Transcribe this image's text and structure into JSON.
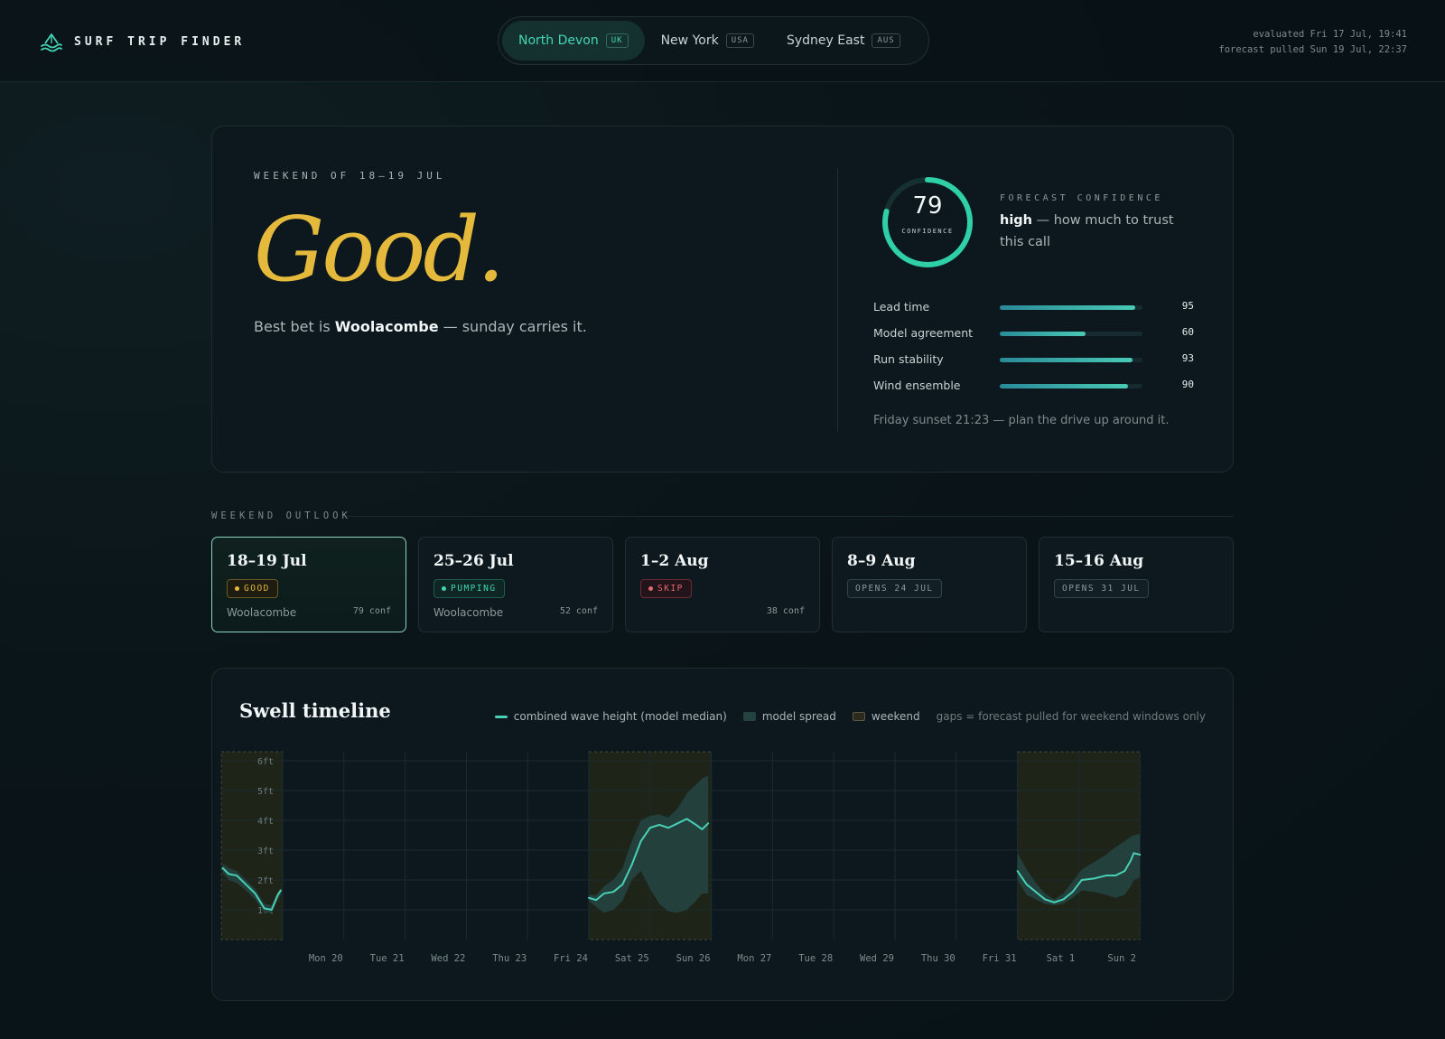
{
  "app": {
    "name": "SURF TRIP FINDER"
  },
  "locations": [
    {
      "name": "North Devon",
      "code": "UK",
      "active": true
    },
    {
      "name": "New York",
      "code": "USA",
      "active": false
    },
    {
      "name": "Sydney East",
      "code": "AUS",
      "active": false
    }
  ],
  "meta": {
    "evaluated": "evaluated Fri 17 Jul, 19:41",
    "forecast": "forecast pulled Sun 19 Jul, 22:37"
  },
  "hero": {
    "eyebrow": "WEEKEND OF 18–19 JUL",
    "verdict": "Good.",
    "best_prefix": "Best bet is ",
    "best_spot": "Woolacombe",
    "best_suffix": " — sunday carries it.",
    "confidence": {
      "value": 79,
      "ring_label": "CONFIDENCE",
      "label": "FORECAST CONFIDENCE",
      "level": "high",
      "text": " — how much to trust this call",
      "color": "#2fd0a8"
    },
    "metrics": [
      {
        "name": "Lead time",
        "value": 95
      },
      {
        "name": "Model agreement",
        "value": 60
      },
      {
        "name": "Run stability",
        "value": 93
      },
      {
        "name": "Wind ensemble",
        "value": 90
      }
    ],
    "sunset_note": "Friday sunset 21:23 — plan the drive up around it."
  },
  "outlook": {
    "title": "WEEKEND OUTLOOK",
    "cards": [
      {
        "dates": "18–19 Jul",
        "status": "GOOD",
        "kind": "good",
        "spot": "Woolacombe",
        "conf": "79 conf",
        "selected": true
      },
      {
        "dates": "25–26 Jul",
        "status": "PUMPING",
        "kind": "pumping",
        "spot": "Woolacombe",
        "conf": "52 conf",
        "selected": false
      },
      {
        "dates": "1–2 Aug",
        "status": "SKIP",
        "kind": "skip",
        "spot": "",
        "conf": "38 conf",
        "selected": false
      },
      {
        "dates": "8–9 Aug",
        "status": "OPENS 24 JUL",
        "kind": "opens",
        "spot": "",
        "conf": "",
        "selected": false
      },
      {
        "dates": "15–16 Aug",
        "status": "OPENS 31 JUL",
        "kind": "opens",
        "spot": "",
        "conf": "",
        "selected": false
      }
    ]
  },
  "swell": {
    "title": "Swell timeline",
    "legend": {
      "median": "combined wave height (model median)",
      "spread": "model spread",
      "weekend": "weekend",
      "note": "gaps = forecast pulled for weekend windows only"
    }
  },
  "chart_data": {
    "type": "line",
    "title": "Swell timeline",
    "xlabel": "",
    "ylabel": "",
    "y_unit": "ft",
    "ylim": [
      0,
      6.3
    ],
    "yticks": [
      "1ft",
      "2ft",
      "3ft",
      "4ft",
      "5ft",
      "6ft"
    ],
    "xticks": [
      "Mon 20",
      "Tue 21",
      "Wed 22",
      "Thu 23",
      "Fri 24",
      "Sat 25",
      "Sun 26",
      "Mon 27",
      "Tue 28",
      "Wed 29",
      "Thu 30",
      "Fri 31",
      "Sat 1",
      "Sun 2"
    ],
    "x_unit": "days from Sun 19 Jul 00:00",
    "weekends": [
      [
        -1,
        0
      ],
      [
        5,
        7
      ],
      [
        12,
        14
      ]
    ],
    "series": [
      {
        "name": "combined wave height (model median)",
        "color": "#49d1b6",
        "segments": [
          [
            [
              -0.98,
              2.4
            ],
            [
              -0.88,
              2.2
            ],
            [
              -0.75,
              2.15
            ],
            [
              -0.6,
              1.85
            ],
            [
              -0.45,
              1.55
            ],
            [
              -0.3,
              1.05
            ],
            [
              -0.18,
              1.0
            ],
            [
              -0.08,
              1.5
            ],
            [
              -0.03,
              1.65
            ]
          ],
          [
            [
              5.0,
              1.4
            ],
            [
              5.12,
              1.33
            ],
            [
              5.25,
              1.55
            ],
            [
              5.4,
              1.6
            ],
            [
              5.55,
              1.85
            ],
            [
              5.7,
              2.5
            ],
            [
              5.85,
              3.3
            ],
            [
              6.0,
              3.75
            ],
            [
              6.15,
              3.85
            ],
            [
              6.3,
              3.75
            ],
            [
              6.45,
              3.9
            ],
            [
              6.6,
              4.05
            ],
            [
              6.75,
              3.85
            ],
            [
              6.85,
              3.7
            ],
            [
              6.95,
              3.9
            ]
          ],
          [
            [
              12.0,
              2.3
            ],
            [
              12.15,
              1.85
            ],
            [
              12.3,
              1.6
            ],
            [
              12.45,
              1.35
            ],
            [
              12.6,
              1.25
            ],
            [
              12.75,
              1.35
            ],
            [
              12.9,
              1.6
            ],
            [
              13.05,
              2.0
            ],
            [
              13.25,
              2.05
            ],
            [
              13.45,
              2.15
            ],
            [
              13.6,
              2.15
            ],
            [
              13.75,
              2.3
            ],
            [
              13.85,
              2.65
            ],
            [
              13.9,
              2.9
            ],
            [
              14.0,
              2.85
            ]
          ]
        ]
      },
      {
        "name": "model spread",
        "color": "#24423f",
        "segments": [
          [
            [
              -0.98,
              2.55,
              2.25
            ],
            [
              -0.88,
              2.4,
              2.0
            ],
            [
              -0.75,
              2.3,
              1.9
            ],
            [
              -0.6,
              2.0,
              1.65
            ],
            [
              -0.45,
              1.7,
              1.35
            ],
            [
              -0.3,
              1.2,
              0.9
            ],
            [
              -0.18,
              1.15,
              0.9
            ],
            [
              -0.08,
              1.6,
              1.35
            ],
            [
              -0.03,
              1.75,
              1.5
            ]
          ],
          [
            [
              5.0,
              1.5,
              1.3
            ],
            [
              5.12,
              1.5,
              1.1
            ],
            [
              5.25,
              1.8,
              0.9
            ],
            [
              5.4,
              2.0,
              1.0
            ],
            [
              5.55,
              2.4,
              1.3
            ],
            [
              5.7,
              3.3,
              2.0
            ],
            [
              5.85,
              4.0,
              2.3
            ],
            [
              6.0,
              4.15,
              1.7
            ],
            [
              6.15,
              4.2,
              1.2
            ],
            [
              6.3,
              4.1,
              0.95
            ],
            [
              6.45,
              4.4,
              0.9
            ],
            [
              6.6,
              4.9,
              1.0
            ],
            [
              6.75,
              5.2,
              1.3
            ],
            [
              6.85,
              5.4,
              1.55
            ],
            [
              6.95,
              5.5,
              1.55
            ]
          ],
          [
            [
              12.0,
              2.9,
              2.0
            ],
            [
              12.15,
              2.35,
              1.5
            ],
            [
              12.3,
              1.9,
              1.35
            ],
            [
              12.45,
              1.55,
              1.2
            ],
            [
              12.6,
              1.35,
              1.15
            ],
            [
              12.75,
              1.55,
              1.2
            ],
            [
              12.9,
              1.95,
              1.4
            ],
            [
              13.05,
              2.35,
              1.65
            ],
            [
              13.25,
              2.6,
              1.6
            ],
            [
              13.45,
              2.85,
              1.5
            ],
            [
              13.6,
              3.1,
              1.4
            ],
            [
              13.75,
              3.3,
              1.5
            ],
            [
              13.85,
              3.45,
              1.8
            ],
            [
              13.9,
              3.5,
              2.0
            ],
            [
              14.0,
              3.55,
              2.1
            ]
          ]
        ]
      }
    ],
    "grid": true,
    "legend_position": "top-right"
  }
}
